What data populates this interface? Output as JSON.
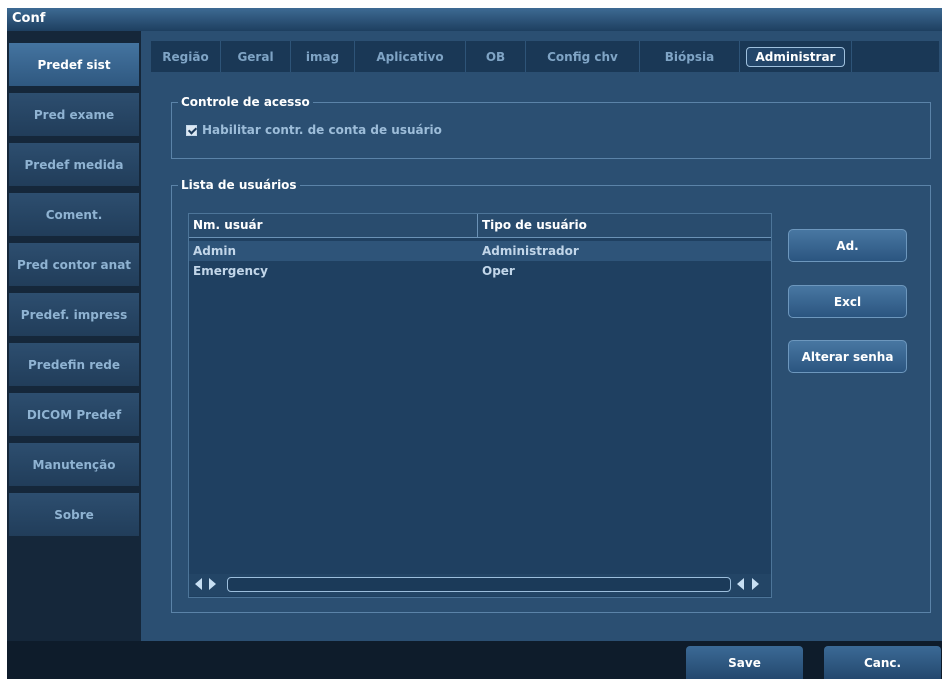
{
  "window": {
    "title": "Conf"
  },
  "sidebar": {
    "items": [
      {
        "label": "Predef sist",
        "active": true
      },
      {
        "label": "Pred exame"
      },
      {
        "label": "Predef medida"
      },
      {
        "label": "Coment."
      },
      {
        "label": "Pred contor anat"
      },
      {
        "label": "Predef. impress"
      },
      {
        "label": "Predefin rede"
      },
      {
        "label": "DICOM Predef"
      },
      {
        "label": "Manutenção"
      },
      {
        "label": "Sobre"
      }
    ]
  },
  "tabs": [
    {
      "label": "Região"
    },
    {
      "label": "Geral"
    },
    {
      "label": "imag"
    },
    {
      "label": "Aplicativo"
    },
    {
      "label": "OB"
    },
    {
      "label": "Config chv"
    },
    {
      "label": "Biópsia"
    },
    {
      "label": "Administrar",
      "active": true
    }
  ],
  "access_control": {
    "group_label": "Controle de acesso",
    "checkbox_label": "Habilitar contr. de conta de usuário",
    "checked": true
  },
  "user_list": {
    "group_label": "Lista de usuários",
    "columns": [
      "Nm. usuár",
      "Tipo de usuário"
    ],
    "rows": [
      {
        "name": "Admin",
        "type": "Administrador"
      },
      {
        "name": "Emergency",
        "type": "Oper"
      }
    ]
  },
  "actions": {
    "add": "Ad.",
    "delete": "Excl",
    "change_password": "Alterar senha"
  },
  "footer": {
    "save": "Save",
    "cancel": "Canc."
  }
}
